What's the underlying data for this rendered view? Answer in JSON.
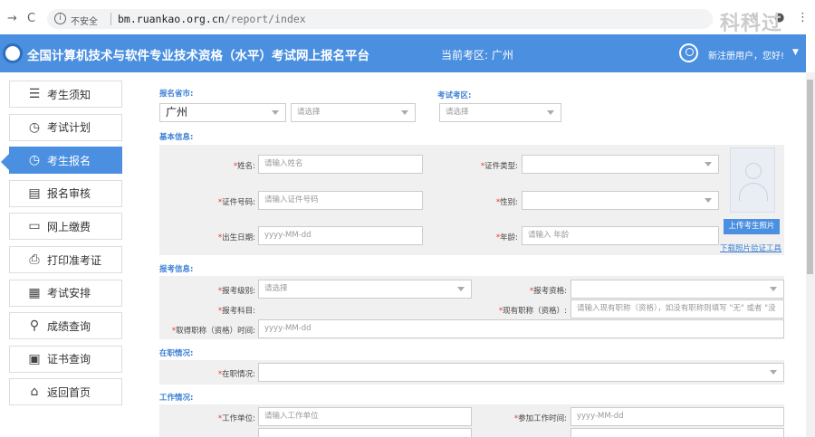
{
  "browser": {
    "insecure_label": "不安全",
    "url_host": "bm.ruankao.org.cn",
    "url_path": "/report/index",
    "watermark": "科科过"
  },
  "header": {
    "title": "全国计算机技术与软件专业技术资格（水平）考试网上报名平台",
    "current_area": "当前考区: 广州",
    "greeting": "新注册用户，您好!"
  },
  "sidebar": {
    "items": [
      {
        "label": "考生须知",
        "icon": "notice-icon"
      },
      {
        "label": "考试计划",
        "icon": "plan-icon"
      },
      {
        "label": "考生报名",
        "icon": "clock-icon"
      },
      {
        "label": "报名审核",
        "icon": "audit-icon"
      },
      {
        "label": "网上缴费",
        "icon": "pay-icon"
      },
      {
        "label": "打印准考证",
        "icon": "print-icon"
      },
      {
        "label": "考试安排",
        "icon": "schedule-icon"
      },
      {
        "label": "成绩查询",
        "icon": "search-icon"
      },
      {
        "label": "证书查询",
        "icon": "certificate-icon"
      },
      {
        "label": "返回首页",
        "icon": "home-icon"
      }
    ],
    "active_index": 2,
    "accent": "#4a8fe0"
  },
  "form": {
    "province": {
      "label": "报名省市:",
      "value": "广州",
      "city_placeholder": "请选择"
    },
    "exam_area": {
      "label": "考试考区:",
      "placeholder": "请选择"
    },
    "basic": {
      "title": "基本信息:",
      "name": {
        "label": "姓名:",
        "placeholder": "请输入姓名"
      },
      "id_type": {
        "label": "证件类型:"
      },
      "id_no": {
        "label": "证件号码:",
        "placeholder": "请输入证件号码"
      },
      "gender": {
        "label": "性别:"
      },
      "birth": {
        "label": "出生日期:",
        "placeholder": "yyyy-MM-dd"
      },
      "age": {
        "label": "年龄:",
        "placeholder": "请输入 年龄"
      },
      "upload_btn": "上传考生照片",
      "download_link": "下载照片验证工具"
    },
    "apply": {
      "title": "报考信息:",
      "level": {
        "label": "报考级别:",
        "placeholder": "请选择"
      },
      "qualification": {
        "label": "报考资格:"
      },
      "subject": {
        "label": "报考科目:"
      },
      "title_now": {
        "label": "现有职称（资格）:",
        "placeholder": "请输入现有职称（资格），如没有职称则填写 \"无\" 或者 \"没"
      },
      "title_time": {
        "label": "取得职称（资格）时间:",
        "placeholder": "yyyy-MM-dd"
      }
    },
    "employment": {
      "title": "在职情况:",
      "status": {
        "label": "在职情况:"
      }
    },
    "work": {
      "title": "工作情况:",
      "unit": {
        "label": "工作单位:",
        "placeholder": "请输入工作单位"
      },
      "start": {
        "label": "参加工作时间:",
        "placeholder": "yyyy-MM-dd"
      }
    }
  }
}
